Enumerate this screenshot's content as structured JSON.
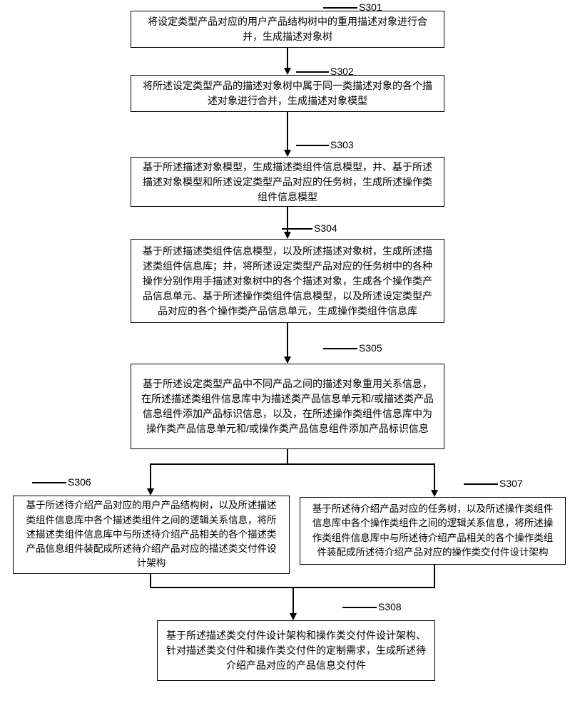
{
  "diagram": {
    "type": "flowchart",
    "steps": {
      "s301": {
        "label": "S301",
        "text": "将设定类型产品对应的用户产品结构树中的重用描述对象进行合并，生成描述对象树"
      },
      "s302": {
        "label": "S302",
        "text": "将所述设定类型产品的描述对象树中属于同一类描述对象的各个描述对象进行合并，生成描述对象模型"
      },
      "s303": {
        "label": "S303",
        "text": "基于所述描述对象模型，生成描述类组件信息模型，并、基于所述描述对象模型和所述设定类型产品对应的任务树，生成所述操作类组件信息模型"
      },
      "s304": {
        "label": "S304",
        "text": "基于所述描述类组件信息模型，以及所述描述对象树，生成所述描述类组件信息库；并，将所述设定类型产品对应的任务树中的各种操作分别作用手描述对象树中的各个描述对象，生成各个操作类产品信息单元、基于所述操作类组件信息模型，以及所述设定类型产品对应的各个操作类产品信息单元，生成操作类组件信息库"
      },
      "s305": {
        "label": "S305",
        "text": "基于所述设定类型产品中不同产品之间的描述对象重用关系信息，在所述描述类组件信息库中为描述类产品信息单元和/或描述类产品信息组件添加产品标识信息，以及，在所述操作类组件信息库中为操作类产品信息单元和/或操作类产品信息组件添加产品标识信息"
      },
      "s306": {
        "label": "S306",
        "text": "基于所述待介绍产品对应的用户产品结构树，以及所述描述类组件信息库中各个描述类组件之间的逻辑关系信息，将所述描述类组件信息库中与所述待介绍产品相关的各个描述类产品信息组件装配成所述待介绍产品对应的描述类交付件设计架构"
      },
      "s307": {
        "label": "S307",
        "text": "基于所述待介绍产品对应的任务树，以及所述操作类组件信息库中各个操作类组件之间的逻辑关系信息，将所述操作类组件信息库中与所述待介绍产品相关的各个操作类组件装配成所述待介绍产品对应的操作类交付件设计架构"
      },
      "s308": {
        "label": "S308",
        "text": "基于所述描述类交付件设计架构和操作类交付件设计架构、针对描述类交付件和操作类交付件的定制需求，生成所述待介绍产品对应的产品信息交付件"
      }
    }
  }
}
